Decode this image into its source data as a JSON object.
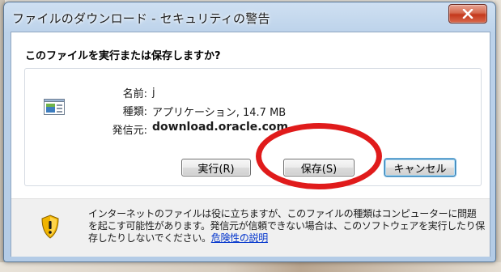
{
  "window": {
    "title": "ファイルのダウンロード - セキュリティの警告"
  },
  "dialog": {
    "question": "このファイルを実行または保存しますか?",
    "file": {
      "name_label": "名前:",
      "name_value": "j",
      "type_label": "種類:",
      "type_value": "アプリケーション, 14.7 MB",
      "from_label": "発信元:",
      "from_value": "download.oracle.com"
    },
    "buttons": {
      "run": "実行(R)",
      "save": "保存(S)",
      "cancel": "キャンセル"
    },
    "warning": {
      "text": "インターネットのファイルは役に立ちますが、このファイルの種類はコンピューターに問題を起こす可能性があります。発信元が信頼できない場合は、このソフトウェアを実行したり保存したりしないでください。",
      "link": "危険性の説明"
    }
  },
  "icons": {
    "file": "application-file-icon",
    "close": "close-icon",
    "warning": "security-shield-icon"
  },
  "colors": {
    "annotation_circle": "#e01b1b",
    "link": "#0033cc",
    "close_button": "#c4381c"
  }
}
